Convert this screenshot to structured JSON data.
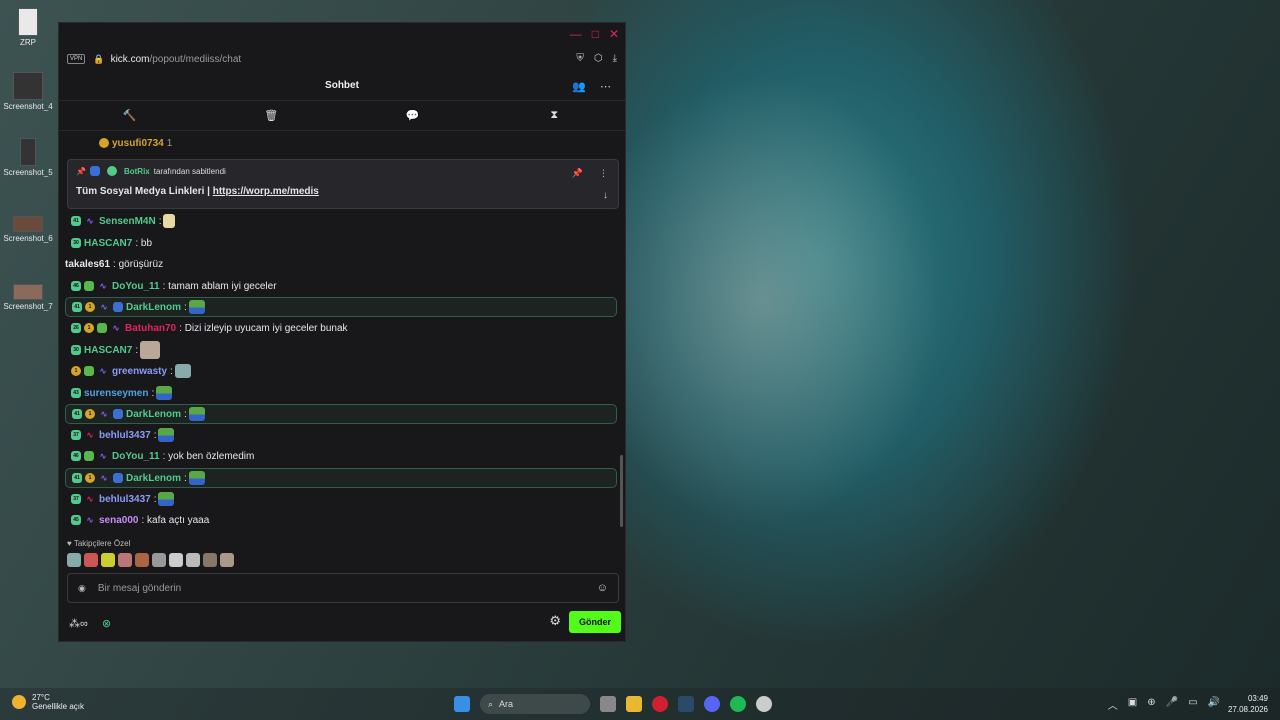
{
  "desktop": {
    "icons": [
      {
        "label": "ZRP"
      },
      {
        "label": "Screenshot_4"
      },
      {
        "label": "Screenshot_5"
      },
      {
        "label": "Screenshot_6"
      },
      {
        "label": "Screenshot_7"
      }
    ]
  },
  "browser": {
    "vpn_label": "VPN",
    "url_host": "kick.com",
    "url_path": "/popout/mediiss/chat"
  },
  "chat": {
    "title": "Sohbet",
    "pinned": {
      "author": "BotRix",
      "meta": "tarafından sabitlendi",
      "text": "Tüm Sosyal Medya Linkleri |",
      "link": "https://worp.me/medis"
    },
    "top_user": {
      "name": "yusufi0734",
      "count": "1"
    },
    "messages": [
      {
        "badges": [
          "41"
        ],
        "user": "SensenM4N",
        "color": "#53c98c",
        "text": ""
      },
      {
        "badges": [
          "30"
        ],
        "user": "HASCAN7",
        "color": "#53c98c",
        "text": "bb"
      },
      {
        "badges": [],
        "user": "takales61",
        "color": "#e6e6e6",
        "text": "görüşürüz"
      },
      {
        "badges": [
          "46"
        ],
        "user": "DoYou_11",
        "color": "#53c98c",
        "text": "tamam ablam iyi geceler"
      },
      {
        "badges": [
          "41",
          "1"
        ],
        "user": "DarkLenom",
        "color": "#53c98c",
        "text": "",
        "highlight": true
      },
      {
        "badges": [
          "26",
          "1"
        ],
        "user": "Batuhan70",
        "color": "#e0245e",
        "text": "Dizi izleyip uyucam iyi geceler bunak"
      },
      {
        "badges": [
          "30"
        ],
        "user": "HASCAN7",
        "color": "#53c98c",
        "text": ""
      },
      {
        "badges": [
          "1"
        ],
        "user": "greenwasty",
        "color": "#8b9cf6",
        "text": ""
      },
      {
        "badges": [
          "43"
        ],
        "user": "surenseymen",
        "color": "#4fa3e0",
        "text": ""
      },
      {
        "badges": [
          "41",
          "1"
        ],
        "user": "DarkLenom",
        "color": "#53c98c",
        "text": "",
        "highlight": true
      },
      {
        "badges": [
          "37"
        ],
        "user": "behlul3437",
        "color": "#8b9cf6",
        "text": ""
      },
      {
        "badges": [
          "46"
        ],
        "user": "DoYou_11",
        "color": "#53c98c",
        "text": "yok ben özlemedim"
      },
      {
        "badges": [
          "41",
          "1"
        ],
        "user": "DarkLenom",
        "color": "#53c98c",
        "text": "",
        "highlight": true
      },
      {
        "badges": [
          "37"
        ],
        "user": "behlul3437",
        "color": "#8b9cf6",
        "text": ""
      },
      {
        "badges": [
          "45"
        ],
        "user": "sena000",
        "color": "#c98bf6",
        "text": "kafa açtı yaaa"
      }
    ],
    "followers_label": "Takipçilere Özel",
    "input_placeholder": "Bir mesaj gönderin",
    "send_label": "Gönder"
  },
  "taskbar": {
    "temperature": "27°C",
    "weather": "Genellikle açık",
    "search": "Ara",
    "time": "03:49",
    "date": "27.08.2026"
  }
}
